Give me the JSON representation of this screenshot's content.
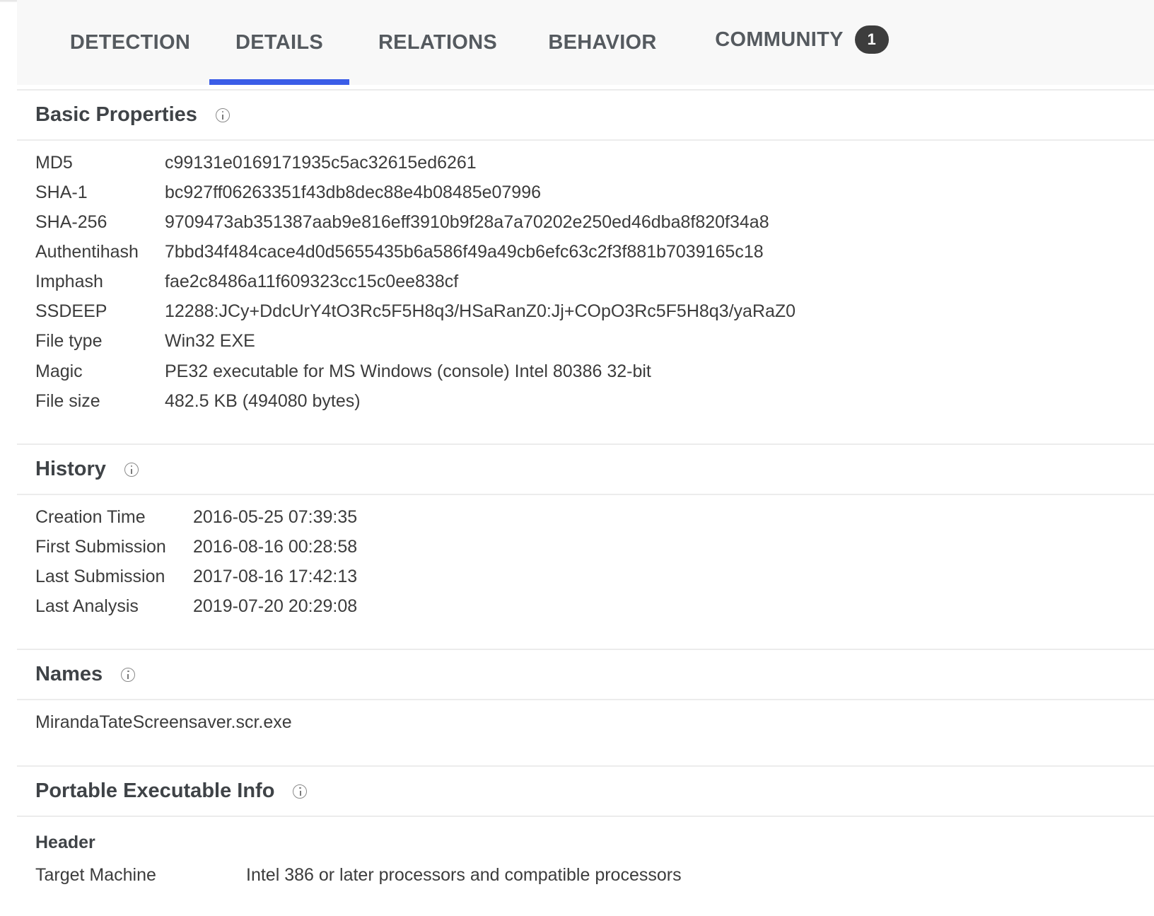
{
  "tabs": [
    {
      "label": "DETECTION"
    },
    {
      "label": "DETAILS"
    },
    {
      "label": "RELATIONS"
    },
    {
      "label": "BEHAVIOR"
    },
    {
      "label": "COMMUNITY",
      "badge": "1"
    }
  ],
  "active_tab": "DETAILS",
  "accent_color": "#3b5de7",
  "basic_properties": {
    "title": "Basic Properties",
    "rows": [
      {
        "key": "MD5",
        "value": "c99131e0169171935c5ac32615ed6261"
      },
      {
        "key": "SHA-1",
        "value": "bc927ff06263351f43db8dec88e4b08485e07996"
      },
      {
        "key": "SHA-256",
        "value": "9709473ab351387aab9e816eff3910b9f28a7a70202e250ed46dba8f820f34a8"
      },
      {
        "key": "Authentihash",
        "value": "7bbd34f484cace4d0d5655435b6a586f49a49cb6efc63c2f3f881b7039165c18"
      },
      {
        "key": "Imphash",
        "value": "fae2c8486a11f609323cc15c0ee838cf"
      },
      {
        "key": "SSDEEP",
        "value": "12288:JCy+DdcUrY4tO3Rc5F5H8q3/HSaRanZ0:Jj+COpO3Rc5F5H8q3/yaRaZ0"
      },
      {
        "key": "File type",
        "value": "Win32 EXE"
      },
      {
        "key": "Magic",
        "value": "PE32 executable for MS Windows (console) Intel 80386 32-bit"
      },
      {
        "key": "File size",
        "value": "482.5 KB (494080 bytes)"
      }
    ]
  },
  "history": {
    "title": "History",
    "rows": [
      {
        "key": "Creation Time",
        "value": "2016-05-25 07:39:35"
      },
      {
        "key": "First Submission",
        "value": "2016-08-16 00:28:58"
      },
      {
        "key": "Last Submission",
        "value": "2017-08-16 17:42:13"
      },
      {
        "key": "Last Analysis",
        "value": "2019-07-20 20:29:08"
      }
    ]
  },
  "names": {
    "title": "Names",
    "items": [
      "MirandaTateScreensaver.scr.exe"
    ]
  },
  "pe_info": {
    "title": "Portable Executable Info",
    "header_title": "Header",
    "rows": [
      {
        "key": "Target Machine",
        "value": "Intel 386 or later processors and compatible processors"
      }
    ]
  }
}
